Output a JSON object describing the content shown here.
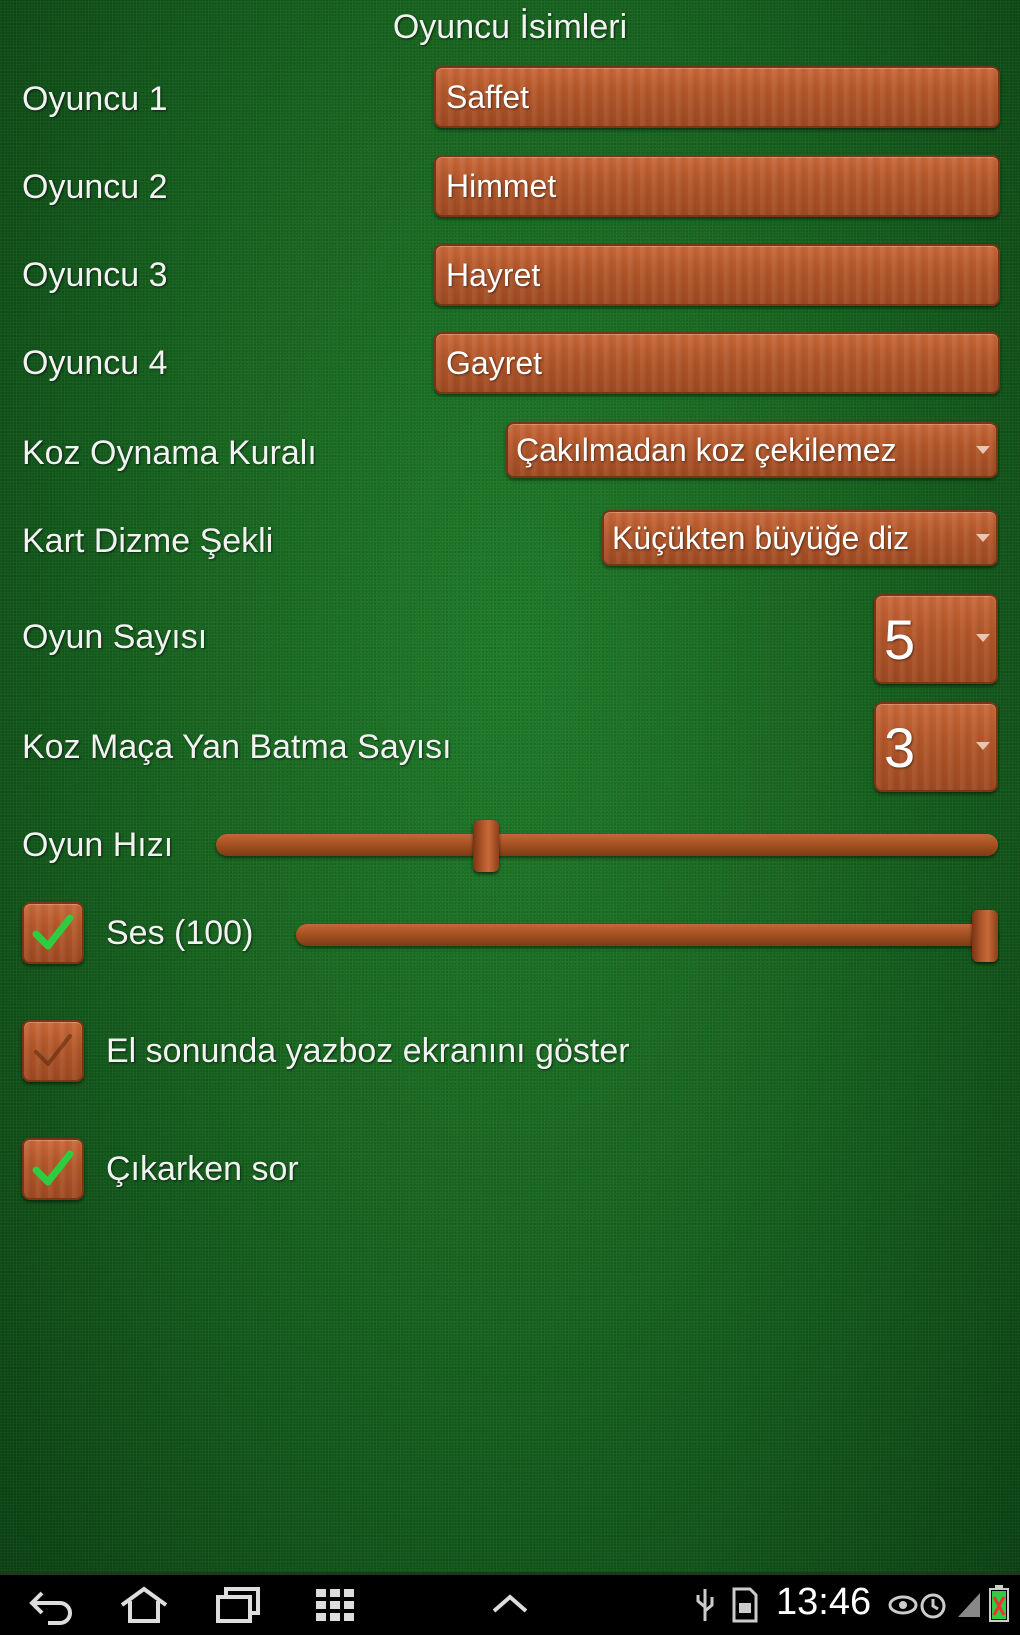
{
  "header": {
    "title": "Oyuncu İsimleri"
  },
  "players": [
    {
      "label": "Oyuncu 1",
      "value": "Saffet"
    },
    {
      "label": "Oyuncu 2",
      "value": "Himmet"
    },
    {
      "label": "Oyuncu 3",
      "value": "Hayret"
    },
    {
      "label": "Oyuncu 4",
      "value": "Gayret"
    }
  ],
  "trump_rule": {
    "label": "Koz Oynama Kuralı",
    "selected": "Çakılmadan koz çekilemez"
  },
  "card_sort": {
    "label": "Kart Dizme Şekli",
    "selected": "Küçükten büyüğe diz"
  },
  "game_count": {
    "label": "Oyun Sayısı",
    "selected": "5"
  },
  "spade_penalty": {
    "label": "Koz Maça Yan Batma Sayısı",
    "selected": "3"
  },
  "game_speed": {
    "label": "Oyun Hızı",
    "level": 0.34
  },
  "sound": {
    "label": "Ses (100)",
    "checked": true,
    "level": 1.0
  },
  "show_score": {
    "label": "El sonunda yazboz ekranını göster",
    "checked": false
  },
  "ask_exit": {
    "label": "Çıkarken sor",
    "checked": true
  },
  "status_bar": {
    "time": "13:46"
  },
  "colors": {
    "felt": "#17641f",
    "wood": "#b5582b",
    "check": "#2ecc40"
  }
}
